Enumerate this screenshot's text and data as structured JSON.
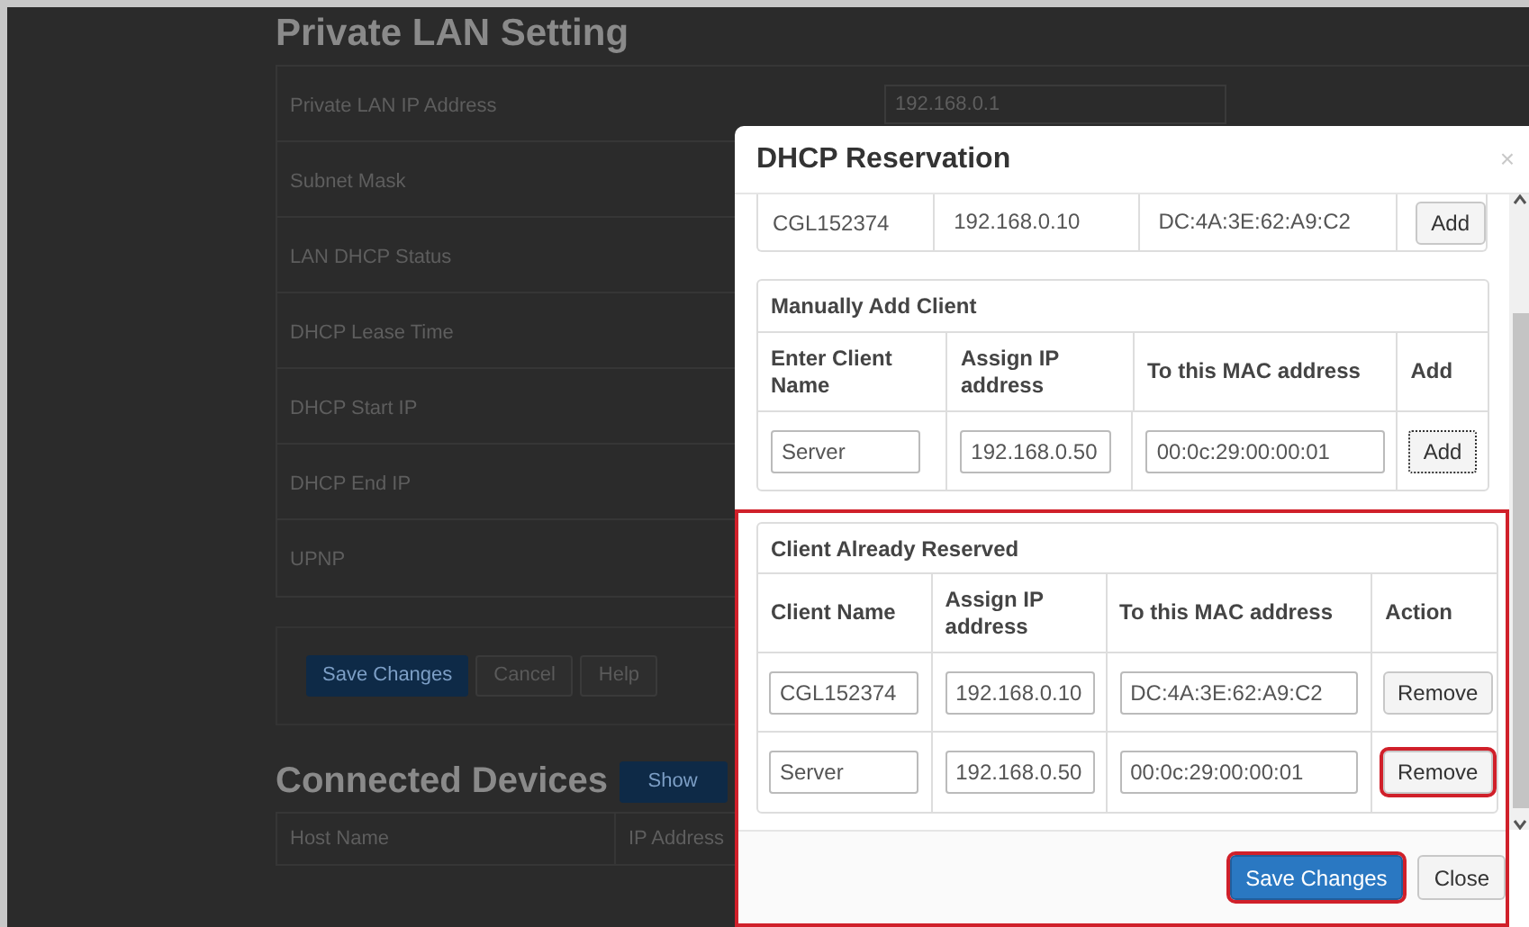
{
  "page": {
    "title": "Private LAN Setting",
    "settings": [
      {
        "label": "Private LAN IP Address",
        "value": "192.168.0.1"
      },
      {
        "label": "Subnet Mask"
      },
      {
        "label": "LAN DHCP Status"
      },
      {
        "label": "DHCP Lease Time"
      },
      {
        "label": "DHCP Start IP"
      },
      {
        "label": "DHCP End IP"
      },
      {
        "label": "UPNP"
      }
    ],
    "buttons": [
      {
        "label": "Save Changes",
        "kind": "primary"
      },
      {
        "label": "Cancel",
        "kind": "default"
      },
      {
        "label": "Help",
        "kind": "default"
      }
    ],
    "devices": {
      "title": "Connected Devices",
      "toggle": "Show",
      "columns": [
        "Host Name",
        "IP Address"
      ]
    }
  },
  "modal": {
    "title": "DHCP Reservation",
    "close": "×",
    "available_row": {
      "name": "CGL152374",
      "ip": "192.168.0.10",
      "mac": "DC:4A:3E:62:A9:C2",
      "action": "Add"
    },
    "manual": {
      "title": "Manually Add Client",
      "columns": [
        "Enter Client Name",
        "Assign IP address",
        "To this MAC address",
        "Add"
      ],
      "row": {
        "name": "Server",
        "ip": "192.168.0.50",
        "mac": "00:0c:29:00:00:01",
        "action": "Add",
        "focused": true
      }
    },
    "reserved": {
      "title": "Client Already Reserved",
      "highlighted": true,
      "columns": [
        "Client Name",
        "Assign IP address",
        "To this MAC address",
        "Action"
      ],
      "rows": [
        {
          "name": "CGL152374",
          "ip": "192.168.0.10",
          "mac": "DC:4A:3E:62:A9:C2",
          "action": "Remove",
          "highlighted": false
        },
        {
          "name": "Server",
          "ip": "192.168.0.50",
          "mac": "00:0c:29:00:00:01",
          "action": "Remove",
          "highlighted": true
        }
      ]
    },
    "footer": [
      {
        "label": "Save Changes",
        "kind": "primary",
        "highlighted": true
      },
      {
        "label": "Close",
        "kind": "default",
        "highlighted": false
      }
    ]
  }
}
